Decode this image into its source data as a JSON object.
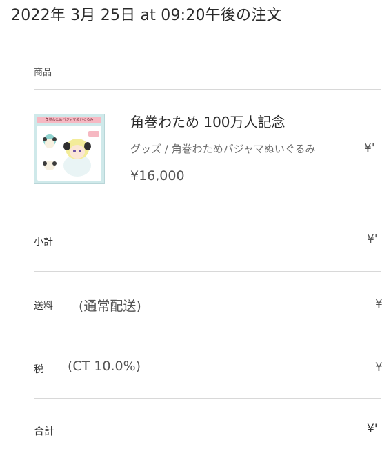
{
  "order": {
    "title": "2022年 3月 25日 at 09:20午後の注文"
  },
  "products_section": {
    "label": "商品"
  },
  "product": {
    "name": "角巻わため 100万人記念",
    "variant": "グッズ / 角巻わためパジャマぬいぐるみ",
    "price": "¥16,000",
    "line_price": "¥'",
    "thumbnail_banner": "角巻わためパジャマぬいぐるみ",
    "colors": {
      "thumb_bg": "#cfe9ea",
      "banner": "#f6b8c2"
    }
  },
  "summary": {
    "subtotal_label": "小計",
    "subtotal_value": "¥'",
    "shipping_label": "送料",
    "shipping_note": "(通常配送)",
    "shipping_value": "¥",
    "tax_label": "税",
    "tax_note": "(CT 10.0%)",
    "tax_value": "¥",
    "total_label": "合計",
    "total_value": "¥'"
  }
}
